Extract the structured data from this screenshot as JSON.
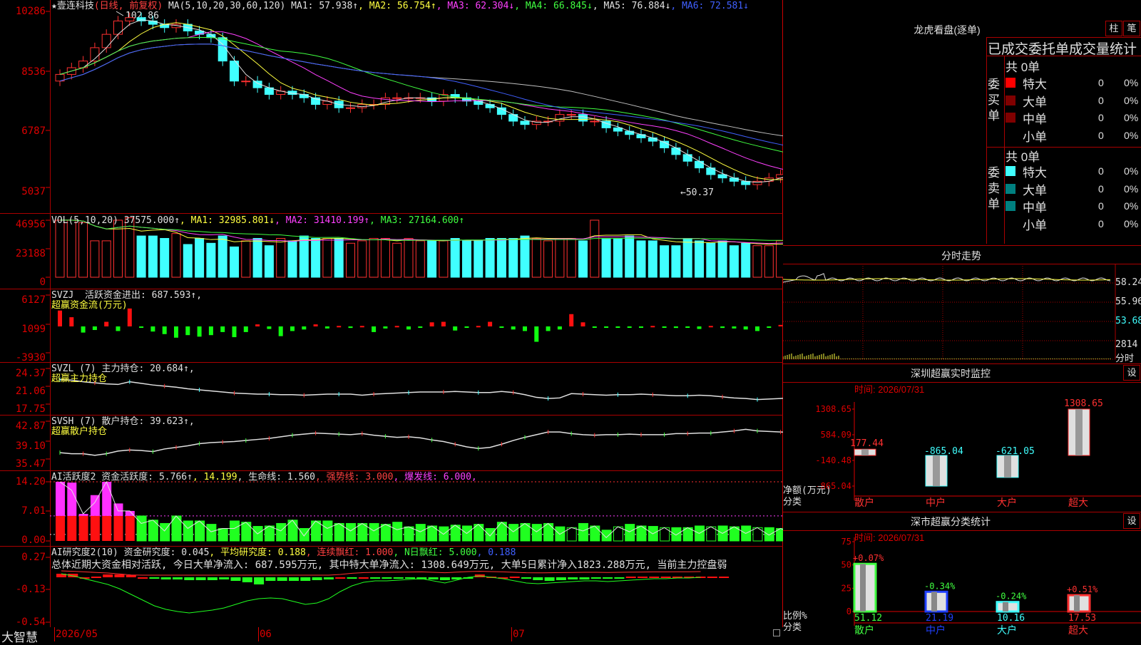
{
  "stock": {
    "star": "★",
    "name": "壹连科技",
    "period": "(日线, 前复权)",
    "ma_label": "MA(5,10,20,30,60,120)",
    "ma": [
      {
        "t": " MA1: 57.938↑",
        "c": "#e0e0e0"
      },
      {
        "t": ", MA2: 56.754↑",
        "c": "#ffff40"
      },
      {
        "t": ", MA3: 62.304↓",
        "c": "#ff40ff"
      },
      {
        "t": ", MA4: 66.845↓",
        "c": "#40ff40"
      },
      {
        "t": ", MA5: 76.884↓",
        "c": "#e0e0e0"
      },
      {
        "t": ", MA6: 72.581↓",
        "c": "#4060ff"
      }
    ],
    "high_label": "102.86",
    "low_label": "←50.37",
    "yticks": [
      "10286",
      "8536",
      "6787",
      "5037"
    ]
  },
  "vol": {
    "label": "VOL(5,10,20)",
    "value": " 37575.000↑",
    "ma": [
      {
        "t": ", MA1: 32985.801↓",
        "c": "#ffff40"
      },
      {
        "t": ", MA2: 31410.199↑",
        "c": "#ff40ff"
      },
      {
        "t": ", MA3: 27164.600↑",
        "c": "#40ff40"
      }
    ],
    "yticks": [
      "46956",
      "23188",
      "0"
    ],
    "values": [
      47,
      47,
      45,
      30,
      30,
      47,
      49,
      34,
      34,
      32,
      36,
      27,
      32,
      28,
      34,
      25,
      30,
      32,
      26,
      32,
      30,
      34,
      32,
      32,
      32,
      28,
      30,
      32,
      32,
      28,
      32,
      30,
      30,
      30,
      32,
      30,
      30,
      32,
      32,
      32,
      34,
      32,
      30,
      32,
      32,
      30,
      47,
      32,
      32,
      34,
      30,
      30,
      26,
      26,
      32,
      30,
      28,
      30,
      26,
      28,
      26,
      26,
      30,
      30,
      28,
      32,
      34,
      34,
      30,
      28,
      30,
      26,
      26,
      34,
      32,
      26,
      28,
      34,
      34,
      28,
      34,
      32,
      30,
      32,
      32,
      40,
      32,
      32,
      30,
      30,
      34,
      28,
      34,
      28,
      28,
      34,
      32,
      30,
      28,
      28,
      26,
      32,
      30,
      34,
      30,
      32,
      32,
      32,
      28,
      30,
      34,
      30,
      28,
      30,
      30,
      30,
      32,
      30,
      32,
      40,
      34,
      42
    ]
  },
  "svzj": {
    "name": "SVZJ",
    "label": "  活跃资金进出: 687.593↑,",
    "sub": "超赢资金流(万元)",
    "yticks": [
      "6127",
      "1099",
      "-3930"
    ],
    "values": [
      3100,
      1800,
      -1200,
      -700,
      900,
      -900,
      3500,
      -200,
      -1000,
      -1500,
      -2200,
      -1700,
      -2000,
      -1700,
      -1100,
      -2100,
      -1100,
      400,
      -500,
      -1900,
      -900,
      -600,
      400,
      -400,
      100,
      -300,
      100,
      -1100,
      -400,
      100,
      -600,
      -100,
      800,
      900,
      -800,
      -200,
      100,
      900,
      -200,
      -600,
      -900,
      -3000,
      -900,
      -600,
      2400,
      800,
      -200,
      -200,
      -100,
      -100,
      -100,
      100,
      -100,
      -300,
      -200,
      -500,
      100,
      -300,
      -400,
      -600,
      -900,
      -200,
      300,
      -500,
      -100,
      -200,
      1400,
      -200,
      1400,
      -1500,
      500
    ]
  },
  "svzl": {
    "name": "SVZL (7)",
    "label": " 主力持仓: 20.684↑,",
    "sub": "超赢主力持仓",
    "yticks": [
      "24.37",
      "21.06",
      "17.75"
    ],
    "values": [
      22.3,
      22.2,
      21.9,
      21.7,
      21.5,
      21.4,
      21.9,
      21.6,
      21.3,
      21.1,
      20.9,
      20.6,
      20.4,
      20.2,
      20.0,
      19.8,
      19.7,
      19.6,
      19.6,
      19.5,
      19.5,
      19.4,
      19.5,
      19.6,
      19.6,
      19.6,
      19.4,
      19.6,
      19.7,
      19.8,
      19.9,
      20.0,
      20.0,
      20.0,
      20.1,
      20.0,
      19.9,
      19.9,
      20.1,
      19.9,
      19.5,
      19.0,
      18.8,
      18.9,
      19.7,
      19.6,
      19.5,
      19.4,
      19.5,
      19.5,
      19.6,
      19.5,
      19.4,
      19.3,
      19.3,
      19.4,
      19.3,
      19.1,
      18.9,
      18.8,
      18.6,
      18.7,
      18.8,
      18.9,
      19.0,
      19.1,
      19.4,
      19.7,
      20.0,
      19.6,
      19.8,
      20.7
    ]
  },
  "svsh": {
    "name": "SVSH (7)",
    "label": " 散户持仓: 39.623↑,",
    "sub": "超赢散户持仓",
    "yticks": [
      "42.87",
      "39.10",
      "35.47"
    ],
    "values": [
      37.2,
      37.0,
      37.0,
      36.7,
      37.0,
      37.5,
      37.7,
      37.6,
      37.4,
      37.9,
      38.2,
      38.5,
      38.9,
      39.1,
      39.2,
      39.3,
      39.5,
      39.7,
      39.9,
      40.2,
      40.5,
      40.7,
      40.9,
      40.8,
      40.7,
      40.6,
      40.8,
      40.5,
      40.3,
      40.1,
      40.2,
      40.0,
      39.6,
      39.3,
      38.8,
      38.3,
      38.0,
      38.2,
      38.8,
      39.5,
      40.1,
      40.6,
      41.1,
      41.1,
      40.8,
      40.6,
      40.5,
      40.6,
      40.6,
      40.7,
      40.6,
      40.6,
      40.6,
      40.8,
      40.8,
      40.9,
      40.9,
      41.1,
      41.3,
      41.6,
      41.3,
      41.2,
      41.1,
      41.0,
      40.8,
      40.6,
      40.1,
      39.8,
      39.6,
      39.4,
      39.9,
      39.7
    ]
  },
  "huoyue": {
    "name": "AI活跃度2",
    "label": " 资金活跃度: 5.766↑",
    "v2": ", 14.199",
    "v3": ", 生命线: 1.560",
    "v4": ", 强势线: 3.000",
    "v5": ", 爆发线: 6.000,",
    "yticks": [
      "14.20",
      "7.01",
      "0.00"
    ],
    "values": [
      14.2,
      14.0,
      6.5,
      11.0,
      14.2,
      9.0,
      7.2,
      6.0,
      5.0,
      4.2,
      6.0,
      4.8,
      4.8,
      4.0,
      3.0,
      4.8,
      4.5,
      3.5,
      3.6,
      4.2,
      5.0,
      3.0,
      4.8,
      4.8,
      4.2,
      4.2,
      4.2,
      4.2,
      4.0,
      4.5,
      3.4,
      4.0,
      3.6,
      3.4,
      3.8,
      3.6,
      4.0,
      3.0,
      4.5,
      4.0,
      4.2,
      4.0,
      4.2,
      3.4,
      3.2,
      4.2,
      3.6,
      2.6,
      3.4,
      4.0,
      3.6,
      3.5,
      3.2,
      3.2,
      3.2,
      3.6,
      3.4,
      3.6,
      3.4,
      3.6,
      3.2,
      3.2,
      3.0,
      3.6,
      3.5,
      3.4,
      3.6,
      3.0,
      3.4,
      3.6,
      3.6
    ]
  },
  "yanjiu": {
    "name": "AI研究度2(10)",
    "label": " 资金研究度: 0.045",
    "v2": ", 平均研究度: 0.188",
    "v3": ", 连续飘红: 1.000",
    "v4": ", N日飘红: 5.000",
    "v5": ", 0.188",
    "summary": "总体近期大资金相对活跃, 今日大单净流入: 687.595万元, 其中特大单净流入: 1308.649万元, 大单5日累计净入1823.288万元, 当前主力控盘弱",
    "yticks": [
      "0.27",
      "-0.13",
      "-0.54"
    ],
    "values": [
      0.05,
      0.05,
      0.0,
      0.01,
      0.04,
      0.04,
      0.03,
      0.0,
      -0.02,
      -0.03,
      -0.03,
      -0.04,
      -0.04,
      -0.04,
      -0.03,
      -0.05,
      -0.07,
      -0.1,
      -0.05,
      -0.05,
      -0.05,
      -0.05,
      -0.04,
      -0.03,
      0.0,
      -0.01,
      0.0,
      -0.01,
      -0.01,
      -0.01,
      -0.02,
      -0.03,
      -0.03,
      -0.04,
      -0.03,
      -0.02,
      0.04,
      0.01,
      0.0,
      0.01,
      -0.01,
      -0.04,
      -0.05,
      -0.04,
      -0.03,
      -0.03,
      -0.02,
      -0.02,
      -0.02,
      0.01,
      0.01,
      0.01,
      0.01,
      0.01,
      0.01,
      0.01,
      0.01,
      0.01
    ]
  },
  "xaxis": {
    "app": "大智慧",
    "d1": "2026/05",
    "d2": "06",
    "d3": "07"
  },
  "longhu": {
    "title": "龙虎看盘(逐单)",
    "btn1": "柱",
    "btn2": "笔",
    "subtitle": "已成交委托单成交量统计",
    "buy_side": "委买单",
    "sell_side": "委卖单",
    "total": "共 0单",
    "rows": [
      {
        "label": "特大",
        "v": "0",
        "pct": "0%"
      },
      {
        "label": "大单",
        "v": "0",
        "pct": "0%"
      },
      {
        "label": "中单",
        "v": "0",
        "pct": "0%"
      },
      {
        "label": "小单",
        "v": "0",
        "pct": "0%"
      }
    ],
    "buy_colors": [
      "#ff0000",
      "#800000",
      "#800000",
      "#000000"
    ],
    "sell_colors": [
      "#40ffff",
      "#008080",
      "#008080",
      "#000000"
    ]
  },
  "fenshi": {
    "title": "分时走势",
    "right_labels": [
      "58.24",
      "55.96",
      "53.68"
    ],
    "vol_label": "2814",
    "vol_unit": "分时"
  },
  "monitor": {
    "title": "深圳超赢实时监控",
    "set": "设",
    "time": "时间: 2026/07/31",
    "yticks": [
      "1308.65",
      "584.09",
      "-140.48",
      "-865.04"
    ],
    "ylabel": "净额(万元)",
    "xlabel": "分类",
    "categories": [
      "散户",
      "中户",
      "大户",
      "超大"
    ],
    "values": [
      177.44,
      -865.04,
      -621.05,
      1308.65
    ],
    "labels": [
      "177.44",
      "-865.04",
      "-621.05",
      "1308.65"
    ]
  },
  "classify": {
    "title": "深市超赢分类统计",
    "set": "设",
    "time": "时间: 2026/07/31",
    "yticks": [
      "75",
      "50",
      "25",
      "0"
    ],
    "ylabel": "比例%",
    "xlabel": "分类",
    "categories": [
      "散户",
      "中户",
      "大户",
      "超大"
    ],
    "values": [
      51.12,
      21.19,
      10.16,
      17.53
    ],
    "labels": [
      "51.12",
      "21.19",
      "10.16",
      "17.53"
    ],
    "changes": [
      "+0.07%",
      "-0.34%",
      "-0.24%",
      "+0.51%"
    ]
  },
  "chart_data": [
    {
      "type": "bar",
      "title": "深圳超赢实时监控",
      "ylabel": "净额(万元)",
      "xlabel": "分类",
      "categories": [
        "散户",
        "中户",
        "大户",
        "超大"
      ],
      "values": [
        177.44,
        -865.04,
        -621.05,
        1308.65
      ],
      "ylim": [
        -865.04,
        1308.65
      ]
    },
    {
      "type": "bar",
      "title": "深市超赢分类统计",
      "ylabel": "比例%",
      "xlabel": "分类",
      "categories": [
        "散户",
        "中户",
        "大户",
        "超大"
      ],
      "values": [
        51.12,
        21.19,
        10.16,
        17.53
      ],
      "ylim": [
        0,
        75
      ]
    },
    {
      "type": "candlestick",
      "ylim": [
        50.37,
        102.86
      ],
      "high": 102.86,
      "low": 50.37
    },
    {
      "type": "bar",
      "title": "VOL(5,10,20)",
      "ylim": [
        0,
        46956
      ]
    }
  ]
}
